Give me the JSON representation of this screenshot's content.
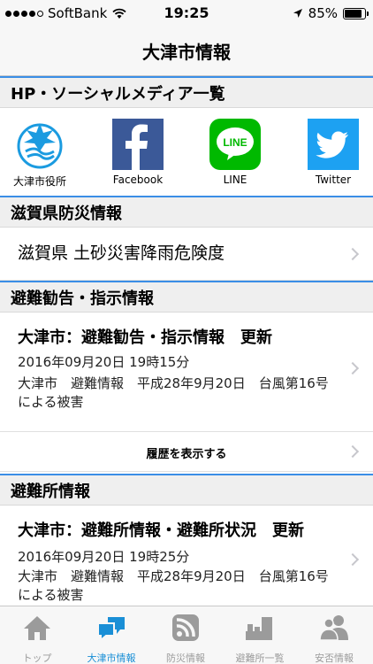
{
  "status_bar": {
    "carrier": "SoftBank",
    "time": "19:25",
    "battery": "85%",
    "battery_level": 0.85
  },
  "nav": {
    "title": "大津市情報"
  },
  "sections": {
    "social": {
      "title": "HP・ソーシャルメディア一覧"
    },
    "disaster": {
      "title": "滋賀県防災情報"
    },
    "evacuation_advisory": {
      "title": "避難勧告・指示情報"
    },
    "shelter": {
      "title": "避難所情報"
    }
  },
  "social_items": [
    {
      "label": "大津市役所",
      "icon": "otsu-city-logo-icon"
    },
    {
      "label": "Facebook",
      "icon": "facebook-icon"
    },
    {
      "label": "LINE",
      "icon": "line-icon",
      "icon_text": "LINE"
    },
    {
      "label": "Twitter",
      "icon": "twitter-icon"
    }
  ],
  "disaster_row": {
    "text": "滋賀県 土砂災害降雨危険度"
  },
  "advisory_news": {
    "title": "大津市：避難勧告・指示情報　更新",
    "date": "2016年09月20日 19時15分",
    "body": "大津市　避難情報　平成28年9月20日　台風第16号による被害"
  },
  "history": {
    "label": "履歴を表示する"
  },
  "shelter_news": {
    "title": "大津市：避難所情報・避難所状況　更新",
    "date": "2016年09月20日 19時25分",
    "body": "大津市　避難情報　平成28年9月20日　台風第16号による被害"
  },
  "tabs": [
    {
      "label": "トップ",
      "icon": "home-icon"
    },
    {
      "label": "大津市情報",
      "icon": "chat-bubbles-icon",
      "active": true
    },
    {
      "label": "防災情報",
      "icon": "rss-icon"
    },
    {
      "label": "避難所一覧",
      "icon": "shelter-icon"
    },
    {
      "label": "安否情報",
      "icon": "people-icon"
    }
  ],
  "colors": {
    "accent": "#1a8fd6",
    "section_border": "#3a8ee6",
    "facebook": "#3b5998",
    "line": "#00b900",
    "twitter": "#1da1f2"
  }
}
